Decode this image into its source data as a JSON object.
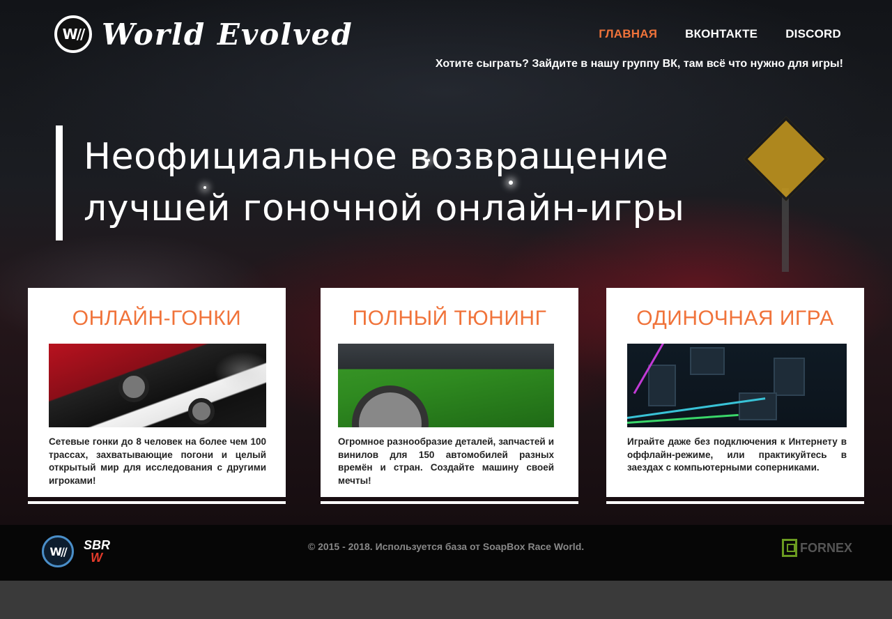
{
  "header": {
    "logo_badge": "W//",
    "logo_text": "World Evolved",
    "nav": [
      {
        "label": "ГЛАВНАЯ",
        "active": true
      },
      {
        "label": "ВКОНТАКТЕ",
        "active": false
      },
      {
        "label": "DISCORD",
        "active": false
      }
    ],
    "tagline": "Хотите сыграть? Зайдите в нашу группу ВК, там всё что нужно для игры!"
  },
  "hero": {
    "title_line1": "Неофициальное возвращение",
    "title_line2": "лучшей гоночной онлайн-игры"
  },
  "cards": [
    {
      "title": "ОНЛАЙН-ГОНКИ",
      "text": "Сетевые гонки до 8 человек на более чем 100 трассах, захватывающие погони и целый открытый мир для исследования с другими игроками!"
    },
    {
      "title": "ПОЛНЫЙ ТЮНИНГ",
      "text": "Огромное разнообразие деталей, запчастей и винилов для 150 автомобилей разных времён и стран. Создайте машину своей мечты!"
    },
    {
      "title": "ОДИНОЧНАЯ ИГРА",
      "text": "Играйте даже без подключения к Интернету в оффлайн-режиме, или практикуйтесь в заездах с компьютерными соперниками."
    }
  ],
  "footer": {
    "badge": "W//",
    "sbr_top": "SBR",
    "sbr_bottom": "W",
    "copyright": "© 2015 - 2018. Используется база от SoapBox Race World.",
    "fornex": "FORNEX"
  },
  "colors": {
    "accent": "#f0733a",
    "footer_bg": "#060606",
    "page_bottom": "#3a3a3a"
  }
}
